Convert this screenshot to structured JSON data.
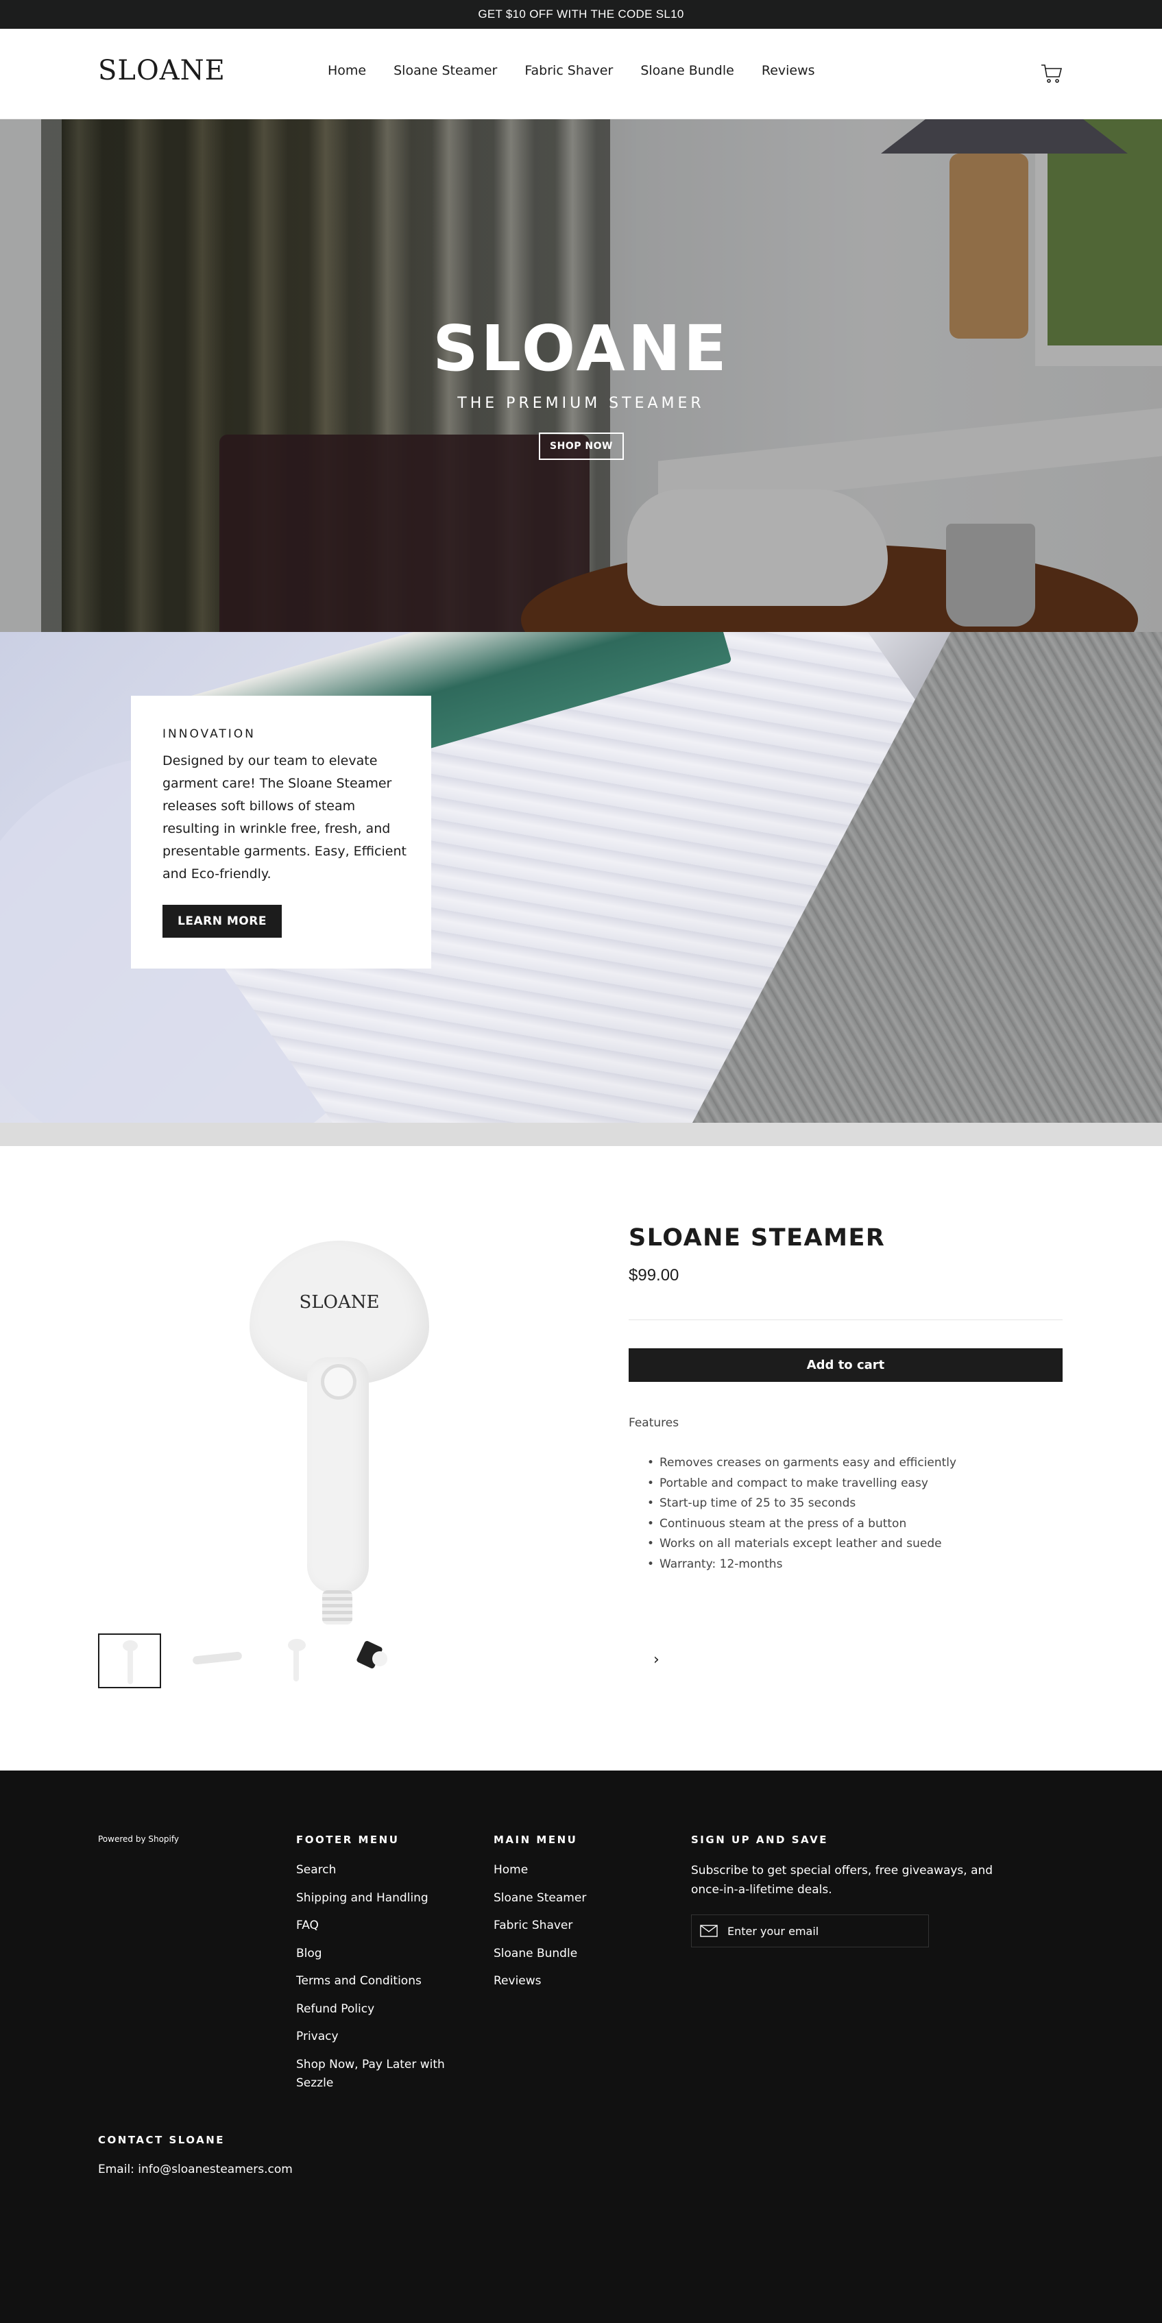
{
  "announcement": "GET $10 OFF WITH THE CODE SL10",
  "header": {
    "logo": "SLOANE",
    "nav": [
      "Home",
      "Sloane Steamer",
      "Fabric Shaver",
      "Sloane Bundle",
      "Reviews"
    ],
    "cart_icon": "cart-icon"
  },
  "hero": {
    "title": "SLOANE",
    "subtitle": "THE PREMIUM STEAMER",
    "button": "SHOP NOW"
  },
  "innovation": {
    "kicker": "INNOVATION",
    "body": "Designed by our team to elevate garment care! The Sloane Steamer releases soft billows of steam resulting in wrinkle free, fresh, and presentable garments. Easy, Efficient and Eco-friendly.",
    "button": "LEARN MORE"
  },
  "product": {
    "image_label": "SLOANE",
    "title": "SLOANE STEAMER",
    "price": "$99.00",
    "add_to_cart": "Add to cart",
    "features_label": "Features",
    "features": [
      "Removes creases on garments easy and efficiently",
      "Portable and compact to make travelling easy",
      "Start-up time of 25 to 35 seconds",
      "Continuous steam at the press of a button",
      "Works on all materials except leather and suede",
      "Warranty: 12-months"
    ],
    "thumbnail_next": "›"
  },
  "footer": {
    "powered": "Powered by Shopify",
    "footer_menu": {
      "heading": "FOOTER MENU",
      "items": [
        "Search",
        "Shipping and Handling",
        "FAQ",
        "Blog",
        "Terms and Conditions",
        "Refund Policy",
        "Privacy",
        "Shop Now, Pay Later with Sezzle"
      ]
    },
    "main_menu": {
      "heading": "MAIN MENU",
      "items": [
        "Home",
        "Sloane Steamer",
        "Fabric Shaver",
        "Sloane Bundle",
        "Reviews"
      ]
    },
    "signup": {
      "heading": "SIGN UP AND SAVE",
      "text": "Subscribe to get special offers, free giveaways, and once-in-a-lifetime deals.",
      "placeholder": "Enter your email"
    },
    "contact": {
      "heading": "CONTACT SLOANE",
      "email": "Email: info@sloanesteamers.com"
    }
  },
  "colors": {
    "dark": "#1c1c1c",
    "footer_bg": "#111111",
    "announcement_bg": "#1c1d1d"
  }
}
